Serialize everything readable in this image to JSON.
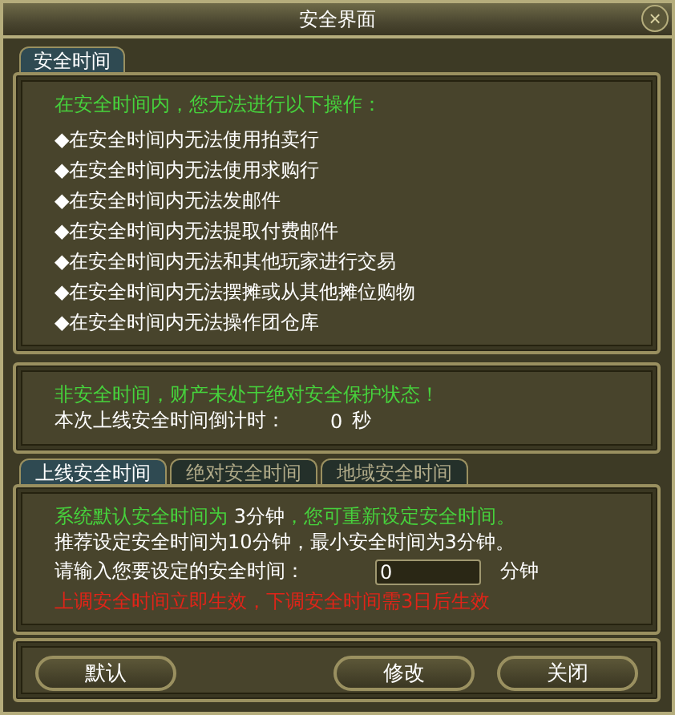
{
  "window": {
    "title": "安全界面",
    "close": "×"
  },
  "top_tabs": [
    {
      "label": "安全时间",
      "selected": true
    }
  ],
  "restrictions": {
    "heading": "在安全时间内，您无法进行以下操作：",
    "items": [
      "◆在安全时间内无法使用拍卖行",
      "◆在安全时间内无法使用求购行",
      "◆在安全时间内无法发邮件",
      "◆在安全时间内无法提取付费邮件",
      "◆在安全时间内无法和其他玩家进行交易",
      "◆在安全时间内无法摆摊或从其他摊位购物",
      "◆在安全时间内无法操作团仓库"
    ]
  },
  "status": {
    "warning": "非安全时间，财产未处于绝对安全保护状态！",
    "countdown_label": "本次上线安全时间倒计时：",
    "countdown_value": "0",
    "countdown_unit": "秒"
  },
  "sub_tabs": [
    {
      "label": "上线安全时间",
      "selected": true
    },
    {
      "label": "绝对安全时间",
      "selected": false
    },
    {
      "label": "地域安全时间",
      "selected": false
    }
  ],
  "settings": {
    "notice": [
      {
        "kind": "plain",
        "text": "系统默认安全时间为 "
      },
      {
        "kind": "value",
        "text": "3分钟"
      },
      {
        "kind": "plain",
        "text": "，您可重新设定安全时间。"
      }
    ],
    "recommendation": "推荐设定安全时间为10分钟，最小安全时间为3分钟。",
    "input_label": "请输入您要设定的安全时间：",
    "input_value": "0",
    "input_unit": "分钟",
    "rule": "上调安全时间立即生效，下调安全时间需3日后生效"
  },
  "buttons": [
    "默认",
    "修改",
    "关闭"
  ]
}
